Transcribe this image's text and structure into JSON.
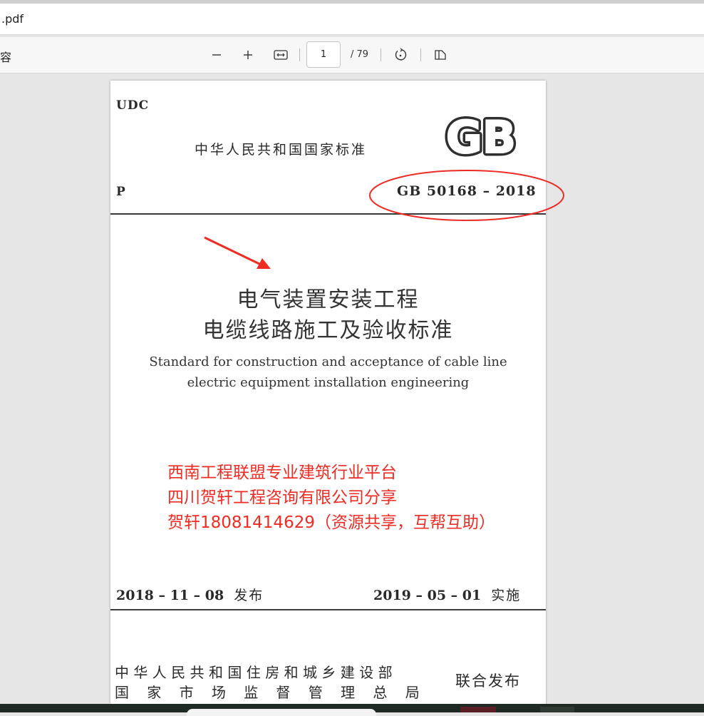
{
  "address_bar": {
    "filename": ".pdf"
  },
  "toolbar": {
    "left_label": "容",
    "zoom_out_icon": "minus-icon",
    "zoom_in_icon": "plus-icon",
    "fit_icon": "fit-width-icon",
    "page_current": "1",
    "page_total": "/ 79",
    "rotate_icon": "rotate-icon",
    "view_icon": "two-page-view-icon"
  },
  "document": {
    "udc": "UDC",
    "national_standard": "中华人民共和国国家标准",
    "logo_text": "GB",
    "p_label": "P",
    "standard_code": "GB 50168 – 2018",
    "title_cn_line1": "电气装置安装工程",
    "title_cn_line2": "电缆线路施工及验收标准",
    "title_en_line1": "Standard for construction and acceptance of cable line",
    "title_en_line2": "electric equipment installation engineering",
    "release_date": "2018 – 11 – 08",
    "release_label": "发布",
    "effective_date": "2019 – 05 – 01",
    "effective_label": "实施",
    "issuer_line1": "中华人民共和国住房和城乡建设部",
    "issuer_line2": "国家市场监督管理总局",
    "joint_issue": "联合发布"
  },
  "watermark": {
    "line1": "西南工程联盟专业建筑行业平台",
    "line2": "四川贺轩工程咨询有限公司分享",
    "line3": "贺轩18081414629（资源共享，互帮互助）"
  },
  "annotation_color": "#ee2c24"
}
